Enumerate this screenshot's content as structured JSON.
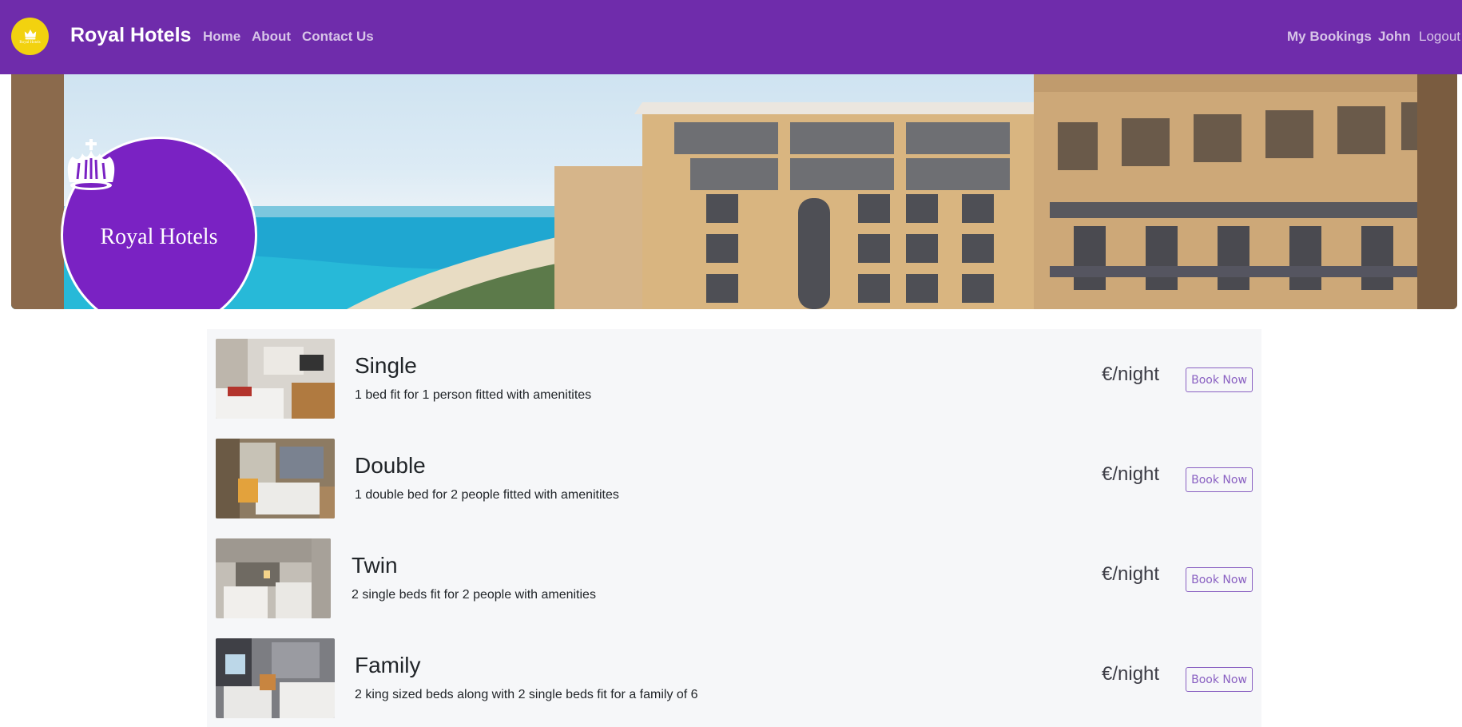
{
  "navbar": {
    "logo_icon": "crown-icon",
    "logo_mini_text": "Royal Hotels",
    "brand": "Royal Hotels",
    "links": [
      "Home",
      "About",
      "Contact Us"
    ],
    "right_links": [
      "My Bookings",
      "John",
      "Logout"
    ],
    "background": "#6f2cab"
  },
  "hero": {
    "badge_icon": "crown-icon",
    "badge_text": "Royal Hotels",
    "badge_color": "#7a22c3"
  },
  "rooms": [
    {
      "name": "Single",
      "description": "1 bed fit for 1 person fitted with amenitites",
      "price": "€/night",
      "button": "Book Now"
    },
    {
      "name": "Double",
      "description": "1 double bed for 2 people fitted with amenitites",
      "price": "€/night",
      "button": "Book Now"
    },
    {
      "name": "Twin",
      "description": "2 single beds fit for 2 people with amenities",
      "price": "€/night",
      "button": "Book Now"
    },
    {
      "name": "Family",
      "description": "2 king sized beds along with 2 single beds fit for a family of 6",
      "price": "€/night",
      "button": "Book Now"
    }
  ]
}
